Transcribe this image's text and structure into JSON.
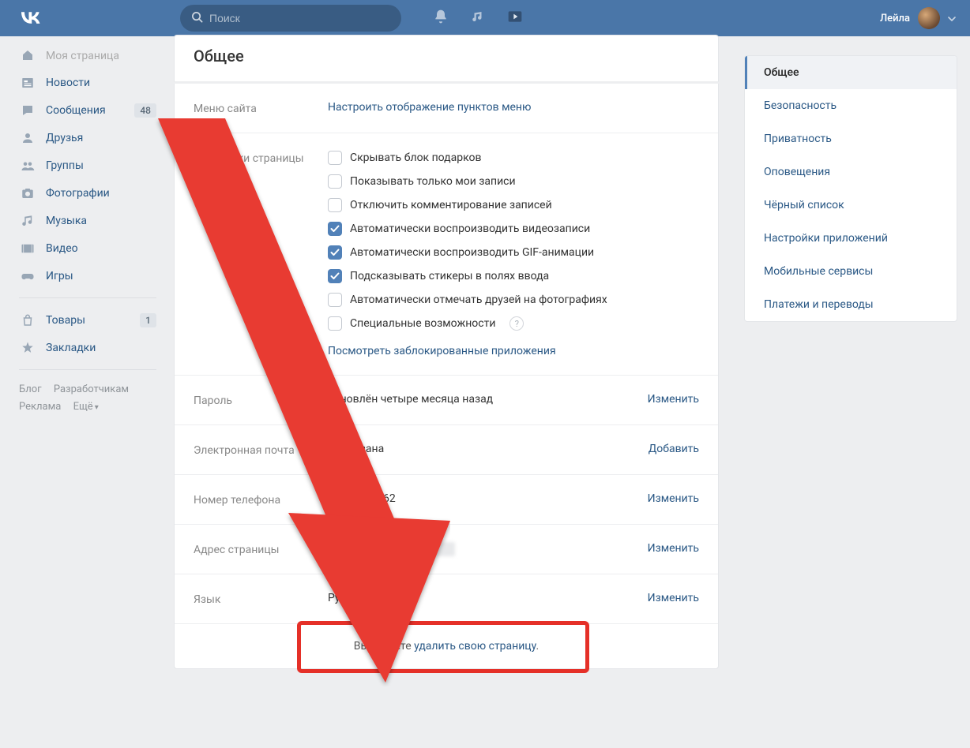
{
  "header": {
    "search_placeholder": "Поиск",
    "username": "Лейла"
  },
  "left_nav": {
    "items": [
      {
        "icon": "home",
        "label": "Моя страница",
        "cut": true
      },
      {
        "icon": "news",
        "label": "Новости"
      },
      {
        "icon": "msg",
        "label": "Сообщения",
        "counter": "48"
      },
      {
        "icon": "friends",
        "label": "Друзья"
      },
      {
        "icon": "groups",
        "label": "Группы"
      },
      {
        "icon": "photos",
        "label": "Фотографии"
      },
      {
        "icon": "music",
        "label": "Музыка"
      },
      {
        "icon": "video",
        "label": "Видео"
      },
      {
        "icon": "games",
        "label": "Игры"
      },
      {
        "sep": true
      },
      {
        "icon": "market",
        "label": "Товары",
        "counter": "1"
      },
      {
        "icon": "bookmark",
        "label": "Закладки"
      }
    ],
    "footer": {
      "blog": "Блог",
      "developers": "Разработчикам",
      "ads": "Реклама",
      "more": "Ещё"
    }
  },
  "page": {
    "title": "Общее",
    "menu_label": "Меню сайта",
    "menu_link": "Настроить отображение пунктов меню",
    "settings_label": "Настройки страницы",
    "checkboxes": [
      {
        "label": "Скрывать блок подарков",
        "checked": false
      },
      {
        "label": "Показывать только мои записи",
        "checked": false
      },
      {
        "label": "Отключить комментирование записей",
        "checked": false
      },
      {
        "label": "Автоматически воспроизводить видеозаписи",
        "checked": true
      },
      {
        "label": "Автоматически воспроизводить GIF-анимации",
        "checked": true
      },
      {
        "label": "Подсказывать стикеры в полях ввода",
        "checked": true
      },
      {
        "label": "Автоматически отмечать друзей на фотографиях",
        "checked": false
      },
      {
        "label": "Специальные возможности",
        "checked": false,
        "help": true
      }
    ],
    "blocked_apps_link": "Посмотреть заблокированные приложения",
    "password": {
      "label": "Пароль",
      "value": "обновлён четыре месяца назад",
      "action": "Изменить"
    },
    "email": {
      "label": "Электронная почта",
      "value": "не указана",
      "action": "Добавить"
    },
    "phone": {
      "label": "Номер телефона",
      "value": "7 *** *** ** 62",
      "action": "Изменить"
    },
    "address": {
      "label": "Адрес страницы",
      "value_prefix": "h",
      "value_mid": ".com",
      "action": "Изменить"
    },
    "language": {
      "label": "Язык",
      "value": "Русский",
      "action": "Изменить"
    },
    "delete": {
      "prefix": "Вы можете ",
      "link": "удалить свою страницу",
      "suffix": "."
    }
  },
  "right_nav": {
    "items": [
      {
        "label": "Общее",
        "active": true
      },
      {
        "label": "Безопасность"
      },
      {
        "label": "Приватность"
      },
      {
        "label": "Оповещения"
      },
      {
        "label": "Чёрный список"
      },
      {
        "label": "Настройки приложений"
      },
      {
        "label": "Мобильные сервисы"
      },
      {
        "label": "Платежи и переводы"
      }
    ]
  }
}
